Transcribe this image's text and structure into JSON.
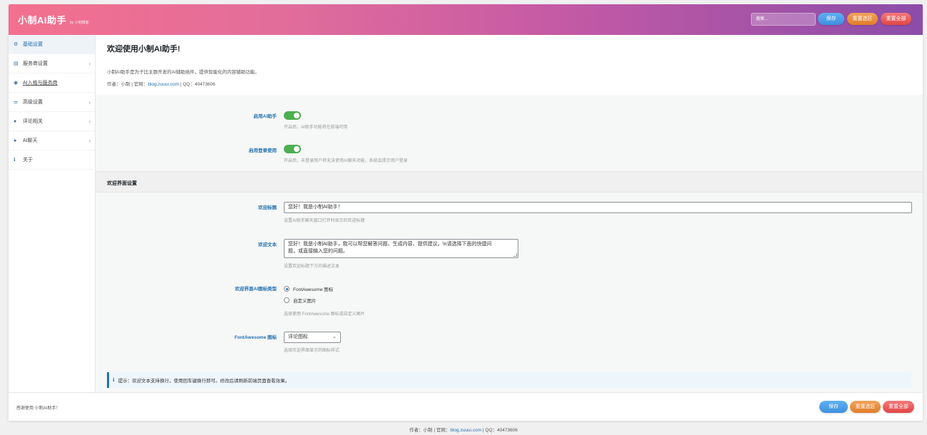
{
  "header": {
    "title": "小制AI助手",
    "subtitle": "by 小制博客",
    "search_placeholder": "搜索...",
    "save_label": "保存",
    "reset_section_label": "重置选区",
    "reset_all_label": "重置全部"
  },
  "sidebar": {
    "items": [
      {
        "label": "基础设置",
        "icon": "gear-icon",
        "glyph": "⚙",
        "has_chevron": false,
        "active": true
      },
      {
        "label": "服务商设置",
        "icon": "server-icon",
        "glyph": "▤",
        "has_chevron": true,
        "active": false
      },
      {
        "label": "AI入格与服务商",
        "icon": "user-circle-icon",
        "glyph": "◉",
        "has_chevron": false,
        "active": false
      },
      {
        "label": "高级设置",
        "icon": "sliders-icon",
        "glyph": "⚌",
        "has_chevron": true,
        "active": false
      },
      {
        "label": "评论相关",
        "icon": "comment-icon",
        "glyph": "●",
        "has_chevron": true,
        "active": false
      },
      {
        "label": "AI聊天",
        "icon": "comments-icon",
        "glyph": "●",
        "has_chevron": true,
        "active": false
      },
      {
        "label": "关于",
        "icon": "info-icon",
        "glyph": "ℹ",
        "has_chevron": false,
        "active": false
      }
    ],
    "chevron": "›"
  },
  "intro": {
    "title": "欢迎使用小制AI助手!",
    "description": "小制AI助手是为子比主题开发的AI辅助插件，提供智能化的内容辅助功能。",
    "meta_prefix": "作者：小制 | 官网：",
    "meta_link": "blog.zuuui.com",
    "meta_suffix": " | QQ：40473606"
  },
  "settings": {
    "enable_ai": {
      "label": "启用AI助手",
      "hint": "开启后，AI助手功能将在前端可用",
      "enabled": true
    },
    "require_login": {
      "label": "启用登录使用",
      "hint": "开启后，未登录用户将无法使用AI聊天功能，系统会提示用户登录",
      "enabled": true
    }
  },
  "welcome_section": {
    "title": "欢迎界面设置",
    "welcome_title": {
      "label": "欢迎标题",
      "value": "您好！我是小制AI助手！",
      "hint": "设置AI助手聊天窗口打开时显示的欢迎标题"
    },
    "welcome_text": {
      "label": "欢迎文本",
      "line1": "您好！我是小制AI助手，我可以帮您解答问题、生成内容、提供建议。\\n请选择下面的快捷问",
      "line2": "题，或直接输入您的问题。",
      "hint": "设置欢迎标题下方的描述文本"
    },
    "icon_type": {
      "label": "欢迎界面AI图标类型",
      "options": [
        "FontAwesome 图标",
        "自定义图片"
      ],
      "selected": "FontAwesome 图标",
      "hint": "选择使用 FontAwesome 图标或自定义图片"
    },
    "fa_icon": {
      "label": "FontAwesome 图标",
      "value": "评论图标",
      "hint": "选择欢迎界面显示的图标样式"
    }
  },
  "notice": {
    "icon": "info-icon",
    "text": "提示：欢迎文本支持换行，使用回车键换行即可。修改后请刷新前端页面查看效果。"
  },
  "footer": {
    "thanks": "感谢使用 小制AI助手！",
    "save_label": "保存",
    "reset_section_label": "重置选区",
    "reset_all_label": "重置全部"
  },
  "page_footer": {
    "prefix": "作者：小制 | 官网：",
    "link": "blog.zuuui.com",
    "suffix": " | QQ：40473606"
  },
  "colors": {
    "header_gradient_start": "#f3708e",
    "header_gradient_end": "#8b4da9",
    "accent": "#2271b1",
    "toggle_on": "#4caf50",
    "save_button": "#3d8fe0",
    "reset_button": "#e07d2a",
    "reset_all_button": "#e04545"
  }
}
